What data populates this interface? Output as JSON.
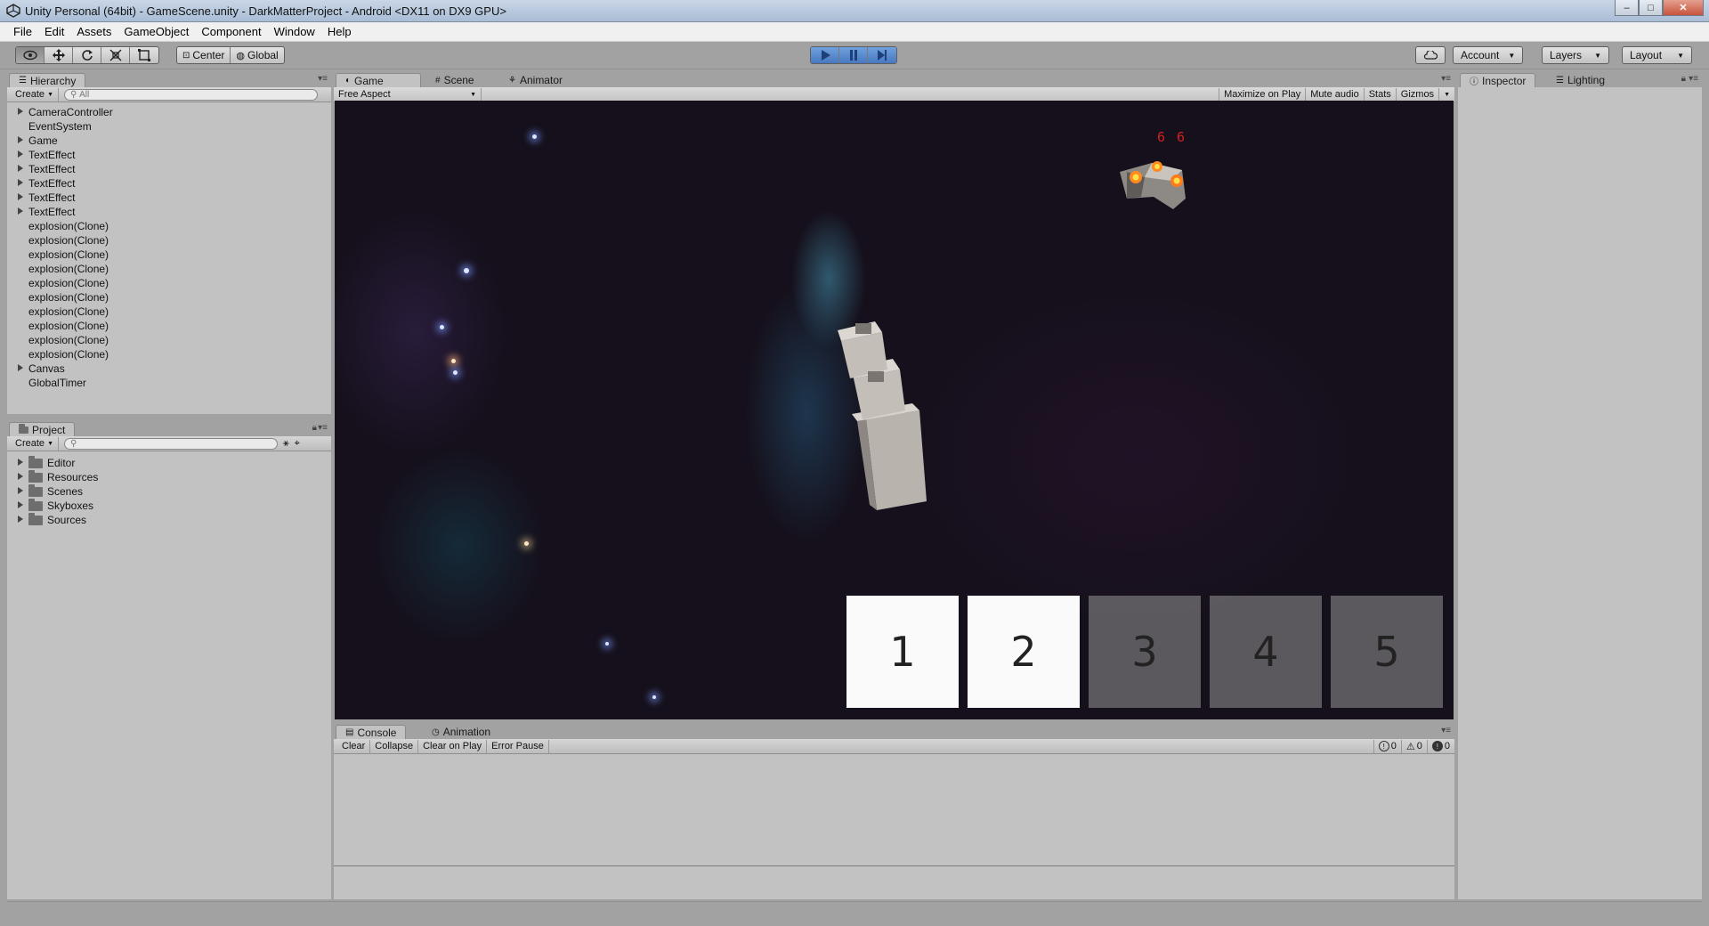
{
  "window": {
    "title": "Unity Personal (64bit) - GameScene.unity - DarkMatterProject - Android <DX11 on DX9 GPU>",
    "minimize": "‒",
    "maximize": "□",
    "close": "✕"
  },
  "menu": [
    "File",
    "Edit",
    "Assets",
    "GameObject",
    "Component",
    "Window",
    "Help"
  ],
  "toolbar": {
    "pivot": "Center",
    "space": "Global",
    "account": "Account",
    "layers": "Layers",
    "layout": "Layout",
    "tools": [
      "hand-tool-icon",
      "move-tool-icon",
      "rotate-tool-icon",
      "scale-tool-icon",
      "rect-tool-icon"
    ],
    "playback": [
      "play-icon",
      "pause-icon",
      "step-icon"
    ]
  },
  "hierarchy": {
    "tab": "Hierarchy",
    "create": "Create",
    "search_placeholder": "All",
    "items": [
      {
        "label": "CameraController",
        "expandable": true
      },
      {
        "label": "EventSystem",
        "expandable": false
      },
      {
        "label": "Game",
        "expandable": true
      },
      {
        "label": "TextEffect",
        "expandable": true
      },
      {
        "label": "TextEffect",
        "expandable": true
      },
      {
        "label": "TextEffect",
        "expandable": true
      },
      {
        "label": "TextEffect",
        "expandable": true
      },
      {
        "label": "TextEffect",
        "expandable": true
      },
      {
        "label": "explosion(Clone)",
        "expandable": false
      },
      {
        "label": "explosion(Clone)",
        "expandable": false
      },
      {
        "label": "explosion(Clone)",
        "expandable": false
      },
      {
        "label": "explosion(Clone)",
        "expandable": false
      },
      {
        "label": "explosion(Clone)",
        "expandable": false
      },
      {
        "label": "explosion(Clone)",
        "expandable": false
      },
      {
        "label": "explosion(Clone)",
        "expandable": false
      },
      {
        "label": "explosion(Clone)",
        "expandable": false
      },
      {
        "label": "explosion(Clone)",
        "expandable": false
      },
      {
        "label": "explosion(Clone)",
        "expandable": false
      },
      {
        "label": "Canvas",
        "expandable": true
      },
      {
        "label": "GlobalTimer",
        "expandable": false
      }
    ]
  },
  "project": {
    "tab": "Project",
    "create": "Create",
    "folders": [
      "Editor",
      "Resources",
      "Scenes",
      "Skyboxes",
      "Sources"
    ]
  },
  "center_tabs": [
    "Game",
    "Scene",
    "Animator"
  ],
  "game": {
    "aspect": "Free Aspect",
    "options": [
      "Maximize on Play",
      "Mute audio",
      "Stats",
      "Gizmos"
    ],
    "score": "6 6",
    "slots": [
      {
        "label": "1",
        "enabled": true
      },
      {
        "label": "2",
        "enabled": true
      },
      {
        "label": "3",
        "enabled": false
      },
      {
        "label": "4",
        "enabled": false
      },
      {
        "label": "5",
        "enabled": false
      }
    ]
  },
  "right_tabs": [
    "Inspector",
    "Lighting"
  ],
  "console": {
    "tabs": [
      "Console",
      "Animation"
    ],
    "buttons": [
      "Clear",
      "Collapse",
      "Clear on Play",
      "Error Pause"
    ],
    "counts": {
      "info": "0",
      "warning": "0",
      "error": "0"
    }
  },
  "colors": {
    "accent": "#4878bf",
    "score": "#d42020"
  }
}
